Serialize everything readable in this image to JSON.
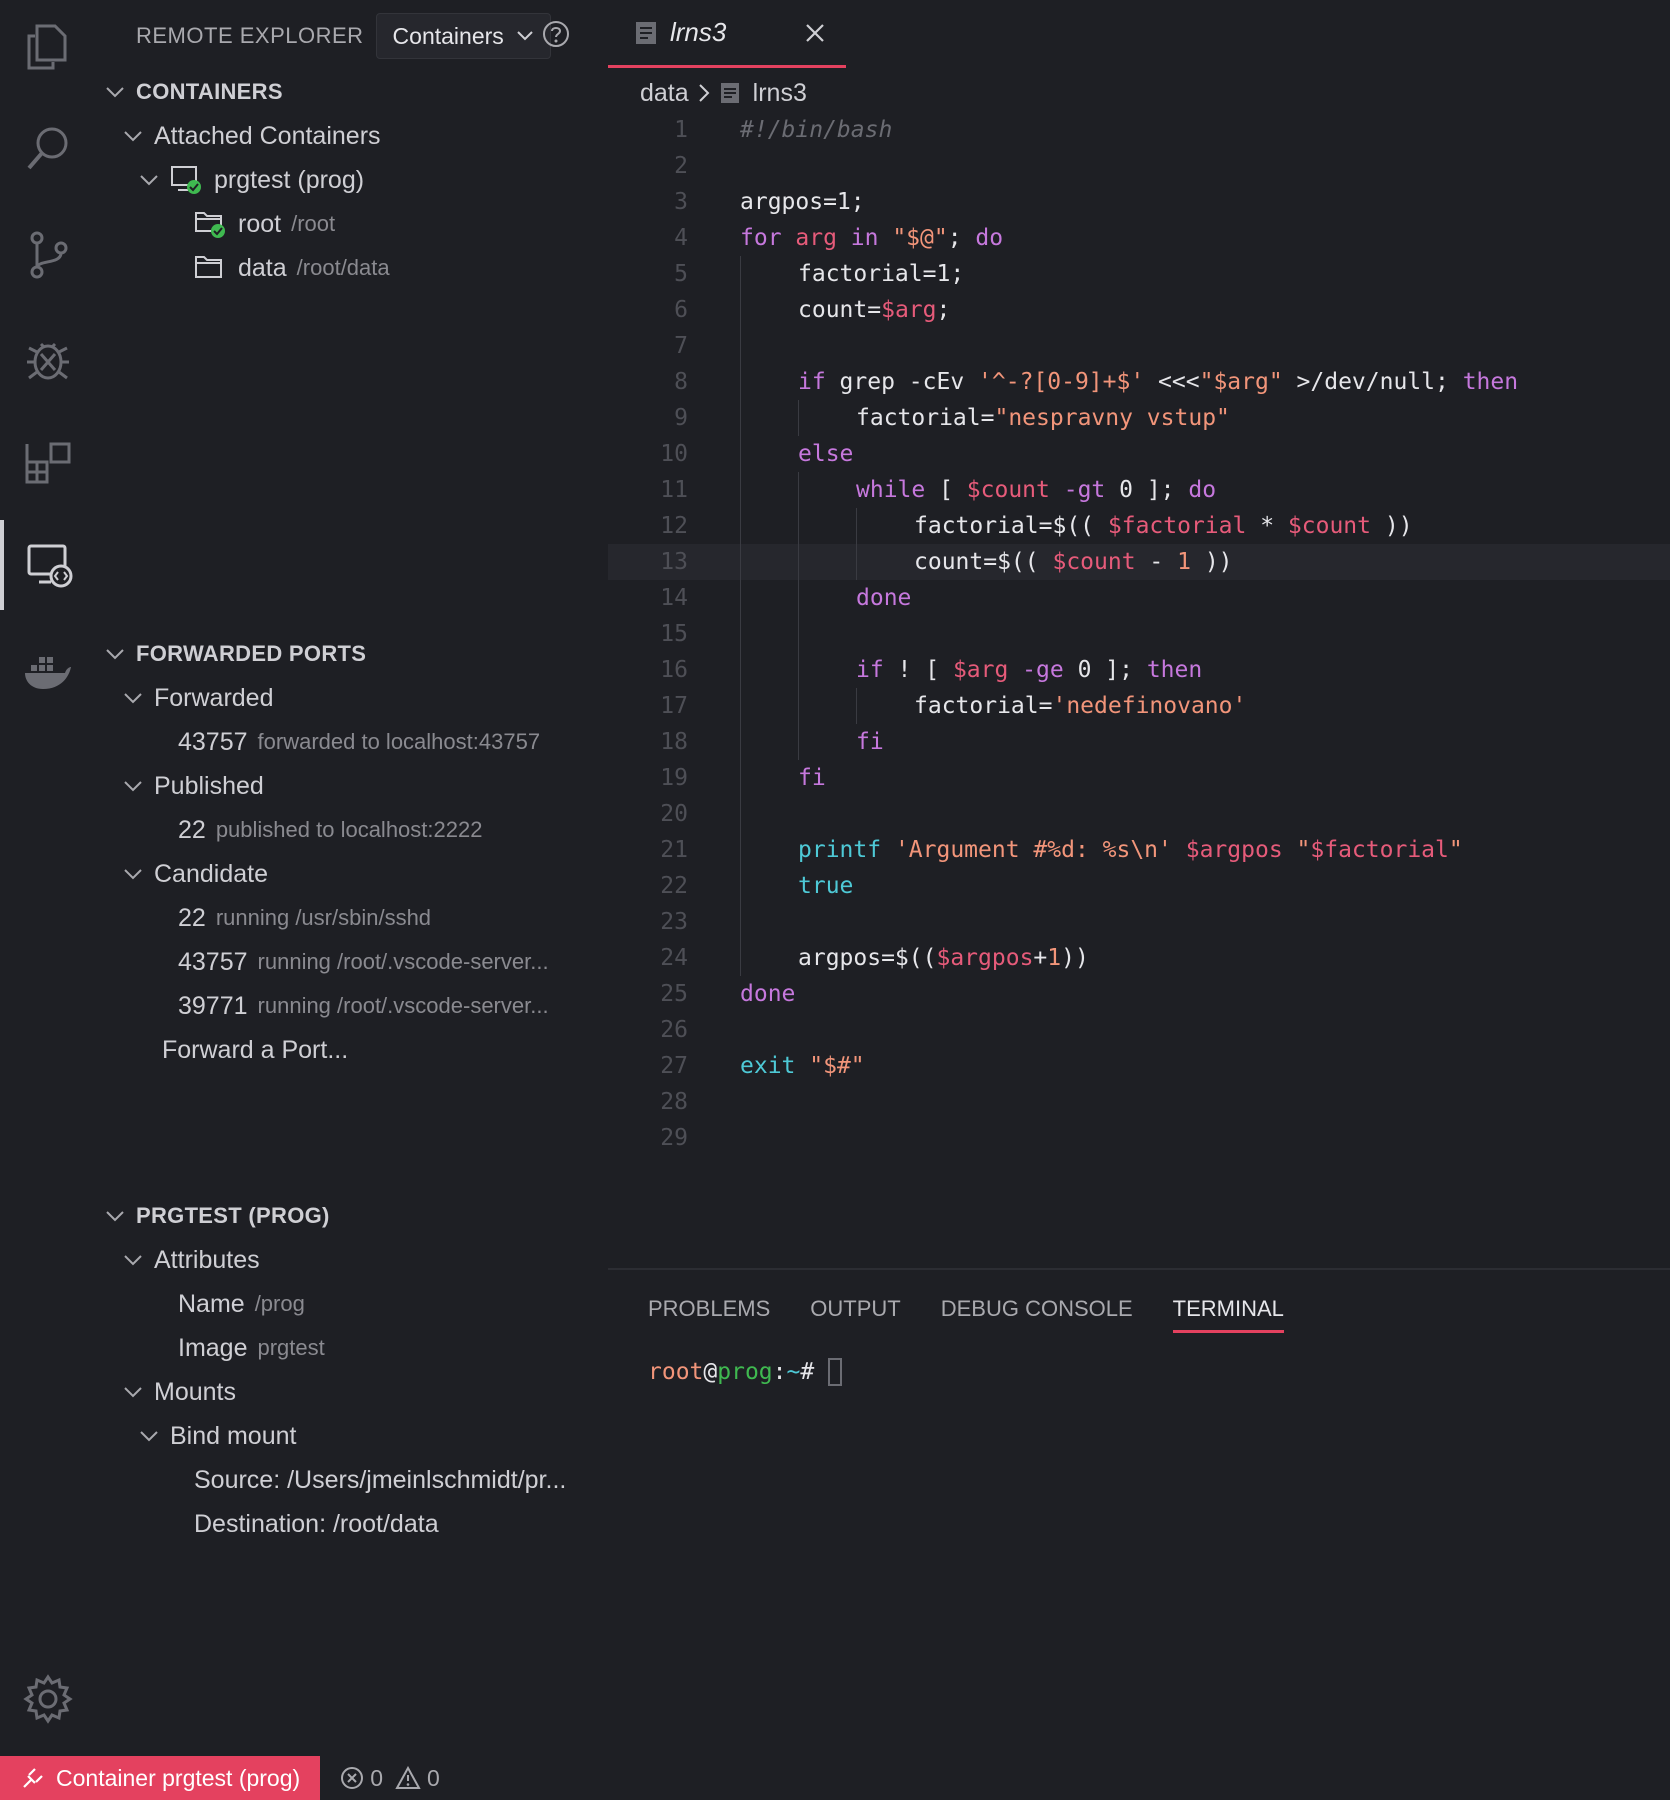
{
  "activity_bar": {
    "icons": [
      "explorer-icon",
      "search-icon",
      "source-control-icon",
      "debug-icon",
      "extensions-icon",
      "remote-explorer-icon",
      "docker-icon"
    ],
    "active": "remote-explorer-icon",
    "settings_icon": "gear-icon"
  },
  "sidebar": {
    "title": "REMOTE EXPLORER",
    "dropdown_value": "Containers",
    "containers": {
      "header": "CONTAINERS",
      "group": "Attached Containers",
      "container": "prgtest (prog)",
      "folders": [
        {
          "name": "root",
          "path": "/root"
        },
        {
          "name": "data",
          "path": "/root/data"
        }
      ]
    },
    "ports": {
      "header": "FORWARDED PORTS",
      "forwarded_label": "Forwarded",
      "forwarded": [
        {
          "port": "43757",
          "desc": "forwarded to localhost:43757"
        }
      ],
      "published_label": "Published",
      "published": [
        {
          "port": "22",
          "desc": "published to localhost:2222"
        }
      ],
      "candidate_label": "Candidate",
      "candidate": [
        {
          "port": "22",
          "desc": "running /usr/sbin/sshd"
        },
        {
          "port": "43757",
          "desc": "running /root/.vscode-server..."
        },
        {
          "port": "39771",
          "desc": "running /root/.vscode-server..."
        }
      ],
      "forward_action": "Forward a Port..."
    },
    "details": {
      "header": "PRGTEST (PROG)",
      "attributes_label": "Attributes",
      "name_label": "Name",
      "name_value": "/prog",
      "image_label": "Image",
      "image_value": "prgtest",
      "mounts_label": "Mounts",
      "bind_label": "Bind mount",
      "source": "Source: /Users/jmeinlschmidt/pr...",
      "destination": "Destination: /root/data"
    }
  },
  "editor": {
    "tab_name": "lrns3",
    "breadcrumb": [
      "data",
      "lrns3"
    ],
    "current_line": 13,
    "lines": [
      {
        "n": "1",
        "indent": 0,
        "tokens": [
          [
            "c",
            "#!/bin/bash"
          ]
        ]
      },
      {
        "n": "2",
        "indent": 0,
        "tokens": []
      },
      {
        "n": "3",
        "indent": 0,
        "tokens": [
          [
            "t",
            "argpos=1;"
          ]
        ]
      },
      {
        "n": "4",
        "indent": 0,
        "tokens": [
          [
            "k",
            "for "
          ],
          [
            "v",
            "arg"
          ],
          [
            "k",
            " in "
          ],
          [
            "s",
            "\"$@\""
          ],
          [
            "t",
            "; "
          ],
          [
            "k",
            "do"
          ]
        ]
      },
      {
        "n": "5",
        "indent": 1,
        "tokens": [
          [
            "t",
            "factorial=1;"
          ]
        ]
      },
      {
        "n": "6",
        "indent": 1,
        "tokens": [
          [
            "t",
            "count="
          ],
          [
            "v",
            "$arg"
          ],
          [
            "t",
            ";"
          ]
        ]
      },
      {
        "n": "7",
        "indent": 1,
        "tokens": []
      },
      {
        "n": "8",
        "indent": 1,
        "tokens": [
          [
            "k",
            "if "
          ],
          [
            "t",
            "grep -cEv "
          ],
          [
            "s",
            "'^-?[0-9]+$'"
          ],
          [
            "t",
            " <<<"
          ],
          [
            "s",
            "\"$arg\""
          ],
          [
            "t",
            " >/dev/null; "
          ],
          [
            "k",
            "then"
          ]
        ]
      },
      {
        "n": "9",
        "indent": 2,
        "tokens": [
          [
            "t",
            "factorial="
          ],
          [
            "s",
            "\"nespravny vstup\""
          ]
        ]
      },
      {
        "n": "10",
        "indent": 1,
        "tokens": [
          [
            "k",
            "else"
          ]
        ]
      },
      {
        "n": "11",
        "indent": 2,
        "tokens": [
          [
            "k",
            "while "
          ],
          [
            "t",
            "[ "
          ],
          [
            "v",
            "$count"
          ],
          [
            "k",
            " -gt "
          ],
          [
            "t",
            "0 ]; "
          ],
          [
            "k",
            "do"
          ]
        ]
      },
      {
        "n": "12",
        "indent": 3,
        "tokens": [
          [
            "t",
            "factorial=$(( "
          ],
          [
            "v",
            "$factorial"
          ],
          [
            "t",
            " * "
          ],
          [
            "v",
            "$count"
          ],
          [
            "t",
            " ))"
          ]
        ]
      },
      {
        "n": "13",
        "indent": 3,
        "tokens": [
          [
            "t",
            "count=$(( "
          ],
          [
            "v",
            "$count"
          ],
          [
            "t",
            " - "
          ],
          [
            "s",
            "1"
          ],
          [
            "t",
            " ))"
          ]
        ]
      },
      {
        "n": "14",
        "indent": 2,
        "tokens": [
          [
            "k",
            "done"
          ]
        ]
      },
      {
        "n": "15",
        "indent": 2,
        "tokens": []
      },
      {
        "n": "16",
        "indent": 2,
        "tokens": [
          [
            "k",
            "if "
          ],
          [
            "t",
            "! [ "
          ],
          [
            "v",
            "$arg"
          ],
          [
            "k",
            " -ge "
          ],
          [
            "t",
            "0 ]; "
          ],
          [
            "k",
            "then"
          ]
        ]
      },
      {
        "n": "17",
        "indent": 3,
        "tokens": [
          [
            "t",
            "factorial="
          ],
          [
            "s",
            "'nedefinovano'"
          ]
        ]
      },
      {
        "n": "18",
        "indent": 2,
        "tokens": [
          [
            "k",
            "fi"
          ]
        ]
      },
      {
        "n": "19",
        "indent": 1,
        "tokens": [
          [
            "k",
            "fi"
          ]
        ]
      },
      {
        "n": "20",
        "indent": 1,
        "tokens": []
      },
      {
        "n": "21",
        "indent": 1,
        "tokens": [
          [
            "b",
            "printf "
          ],
          [
            "s",
            "'Argument #%d: %s\\n'"
          ],
          [
            "v",
            " $argpos"
          ],
          [
            "t",
            " "
          ],
          [
            "s",
            "\""
          ],
          [
            "v",
            "$factorial"
          ],
          [
            "s",
            "\""
          ]
        ]
      },
      {
        "n": "22",
        "indent": 1,
        "tokens": [
          [
            "b",
            "true"
          ]
        ]
      },
      {
        "n": "23",
        "indent": 1,
        "tokens": []
      },
      {
        "n": "24",
        "indent": 1,
        "tokens": [
          [
            "t",
            "argpos=$(("
          ],
          [
            "v",
            "$argpos"
          ],
          [
            "t",
            "+"
          ],
          [
            "s",
            "1"
          ],
          [
            "t",
            "))"
          ]
        ]
      },
      {
        "n": "25",
        "indent": 0,
        "tokens": [
          [
            "k",
            "done"
          ]
        ]
      },
      {
        "n": "26",
        "indent": 0,
        "tokens": []
      },
      {
        "n": "27",
        "indent": 0,
        "tokens": [
          [
            "b",
            "exit "
          ],
          [
            "s",
            "\"$#\""
          ]
        ]
      },
      {
        "n": "28",
        "indent": 0,
        "tokens": []
      },
      {
        "n": "29",
        "indent": 0,
        "tokens": []
      }
    ]
  },
  "panel": {
    "tabs": [
      "PROBLEMS",
      "OUTPUT",
      "DEBUG CONSOLE",
      "TERMINAL"
    ],
    "active_tab": "TERMINAL",
    "terminal": {
      "user": "root",
      "at": "@",
      "host": "prog",
      "colon": ":",
      "path": "~",
      "prompt": "#"
    }
  },
  "status_bar": {
    "remote_label": "Container prgtest (prog)",
    "errors": "0",
    "warnings": "0"
  },
  "colors": {
    "accent": "#e4415f",
    "background": "#1e1f24",
    "keyword": "#c678dd",
    "string": "#f2957a",
    "variable": "#e65b7a",
    "builtin": "#4ec9d6"
  }
}
